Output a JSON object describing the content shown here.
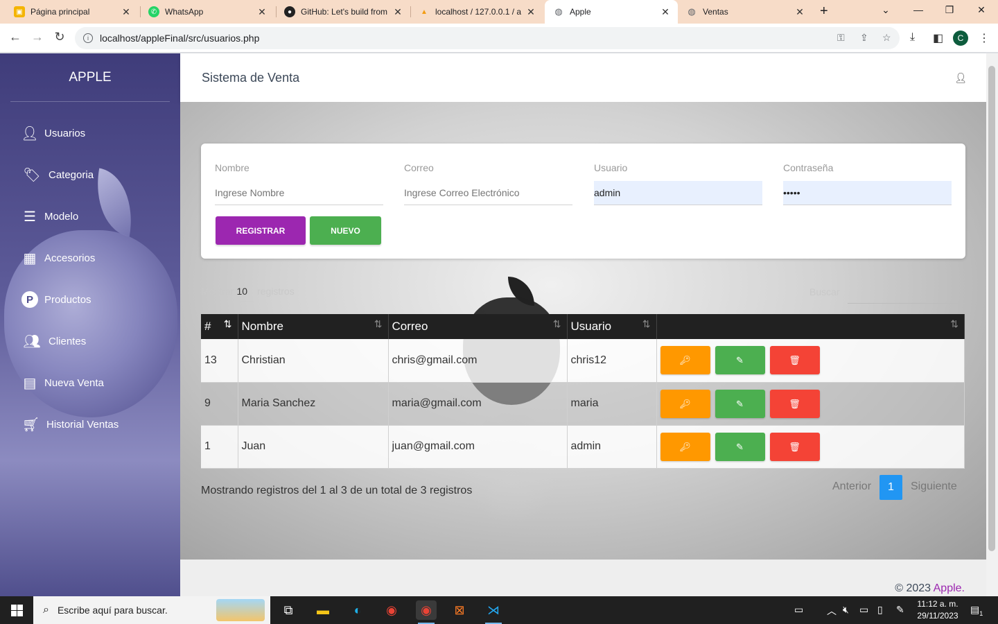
{
  "browser": {
    "tabs": [
      {
        "title": "Página principal",
        "icon": "classroom-icon"
      },
      {
        "title": "WhatsApp",
        "icon": "whatsapp-icon"
      },
      {
        "title": "GitHub: Let's build from",
        "icon": "github-icon"
      },
      {
        "title": "localhost / 127.0.0.1 / a",
        "icon": "phpmyadmin-icon"
      },
      {
        "title": "Apple",
        "icon": "globe-icon"
      },
      {
        "title": "Ventas",
        "icon": "globe-icon"
      }
    ],
    "url": "localhost/appleFinal/src/usuarios.php",
    "profile_initial": "C"
  },
  "sidebar": {
    "brand": "APPLE",
    "items": [
      {
        "label": "Usuarios",
        "icon": "user-icon"
      },
      {
        "label": "Categoria",
        "icon": "tags-icon"
      },
      {
        "label": "Modelo",
        "icon": "list-icon"
      },
      {
        "label": "Accesorios",
        "icon": "building-icon"
      },
      {
        "label": "Productos",
        "icon": "product-p-icon"
      },
      {
        "label": "Clientes",
        "icon": "users-icon"
      },
      {
        "label": "Nueva Venta",
        "icon": "cash-register-icon"
      },
      {
        "label": "Historial Ventas",
        "icon": "cart-plus-icon"
      }
    ]
  },
  "header": {
    "title": "Sistema de Venta"
  },
  "form": {
    "nombre_label": "Nombre",
    "nombre_placeholder": "Ingrese Nombre",
    "correo_label": "Correo",
    "correo_placeholder": "Ingrese Correo Electrónico",
    "usuario_label": "Usuario",
    "usuario_value": "admin",
    "clave_label": "Contraseña",
    "clave_value": "•••••",
    "registrar_label": "REGISTRAR",
    "nuevo_label": "NUEVO"
  },
  "table_controls": {
    "show_prefix": "Mostrar",
    "show_value": "10",
    "show_suffix": "registros",
    "search_label": "Buscar"
  },
  "table": {
    "headers": [
      "#",
      "Nombre",
      "Correo",
      "Usuario",
      ""
    ],
    "rows": [
      {
        "id": "13",
        "nombre": "Christian",
        "correo": "chris@gmail.com",
        "usuario": "chris12"
      },
      {
        "id": "9",
        "nombre": "Maria Sanchez",
        "correo": "maria@gmail.com",
        "usuario": "maria"
      },
      {
        "id": "1",
        "nombre": "Juan",
        "correo": "juan@gmail.com",
        "usuario": "admin"
      }
    ]
  },
  "pagination": {
    "info": "Mostrando registros del 1 al 3 de un total de 3 registros",
    "prev": "Anterior",
    "current": "1",
    "next": "Siguiente"
  },
  "footer": {
    "copyright_prefix": "© 2023",
    "copyright_brand": "Apple",
    "copyright_suffix": "."
  },
  "taskbar": {
    "search_placeholder": "Escribe aquí para buscar.",
    "time": "11:12 a. m.",
    "date": "29/11/2023",
    "notification_count": "1"
  },
  "colors": {
    "registrar": "#9c27b0",
    "nuevo": "#4caf50",
    "key_button": "#ff9800",
    "edit_button": "#4caf50",
    "delete_button": "#f44336",
    "pagination_active": "#2196f3"
  }
}
